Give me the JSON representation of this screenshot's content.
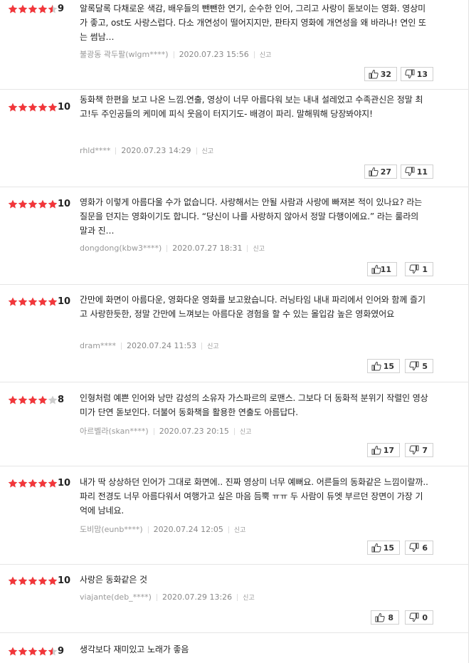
{
  "colors": {
    "star_on": "#f2363a",
    "star_off": "#cccccc"
  },
  "icons": {
    "like": "thumbs-up-icon",
    "dislike": "thumbs-down-icon"
  },
  "reviews": [
    {
      "rating": 9,
      "score": "9",
      "text": "알록달록 다채로운 색감, 배우들의 뺀뺀한 연기, 순수한 인어, 그리고 사랑이 돋보이는 영화. 영상미가 좋고, ost도 사랑스럽다. 다소 개연성이 떨어지지만, 판타지 영화에 개연성을 왜 바라나! 연인 또는 썸남…",
      "user": "불광동 곽두팔(wlgm****)",
      "date": "2020.07.23 15:56",
      "report": "신고",
      "likes": "32",
      "dislikes": "13"
    },
    {
      "rating": 10,
      "score": "10",
      "text": "동화책 한편을 보고 나온 느낌.연출, 영상이 너무 아름다워 보는 내내 설레었고 수족관신은 정말 최고!두 주인공들의 케미에 피식 웃음이 터지기도- 배경이 파리. 말해뭐해 당장봐야지!",
      "user": "rhld****",
      "date": "2020.07.23 14:29",
      "report": "신고",
      "likes": "27",
      "dislikes": "11"
    },
    {
      "rating": 10,
      "score": "10",
      "text": "영화가 이렇게 아름다울 수가 없습니다. 사랑해서는 안될 사람과 사랑에 빠져본 적이 있나요? 라는 질문을 던지는 영화이기도 합니다. “당신이 나를 사랑하지 않아서 정말 다행이에요.” 라는 룰라의 말과 진…",
      "user": "dongdong(kbw3****)",
      "date": "2020.07.27 18:31",
      "report": "신고",
      "likes": "11",
      "dislikes": "1"
    },
    {
      "rating": 10,
      "score": "10",
      "text": "간만에 화면이 아름다운, 영화다운 영화를 보고왔습니다. 러닝타임 내내 파리에서 인어와 함께 즐기고 사랑한듯한, 정말 간만에 느껴보는 아름다운 경험을 할 수 있는 몰입감 높은 영화였어요",
      "user": "dram****",
      "date": "2020.07.24 11:53",
      "report": "신고",
      "likes": "15",
      "dislikes": "5"
    },
    {
      "rating": 8,
      "score": "8",
      "text": "인형처럼 예쁜 인어와 낭만 감성의 소유자 가스파르의 로맨스. 그보다 더 동화적 분위기 작렬인 영상미가 단연 돋보인다. 더불어 동화책을 활용한 연출도 아름답다.",
      "user": "아르벨라(skan****)",
      "date": "2020.07.23 20:15",
      "report": "신고",
      "likes": "17",
      "dislikes": "7"
    },
    {
      "rating": 10,
      "score": "10",
      "text": "내가 딱 상상하던 인어가 그대로 화면에.. 진짜 영상미 너무 예뻐요. 어른들의 동화같은 느낌이랄까.. 파리 전경도 너무 아름다워서 여행가고 싶은 마음 듬뿍 ㅠㅠ 두 사람이 듀엣 부르던 장면이 가장 기억에 남네요.",
      "user": "도비맘(eunb****)",
      "date": "2020.07.24 12:05",
      "report": "신고",
      "likes": "15",
      "dislikes": "6"
    },
    {
      "rating": 10,
      "score": "10",
      "text": "사랑은 동화같은 것",
      "user": "viajante(deb_****)",
      "date": "2020.07.29 13:26",
      "report": "신고",
      "likes": "8",
      "dislikes": "0"
    },
    {
      "rating": 9,
      "score": "9",
      "text": "생각보다 재미있고 노래가 좋음",
      "user": "",
      "date": "",
      "report": "",
      "likes": "",
      "dislikes": ""
    }
  ]
}
